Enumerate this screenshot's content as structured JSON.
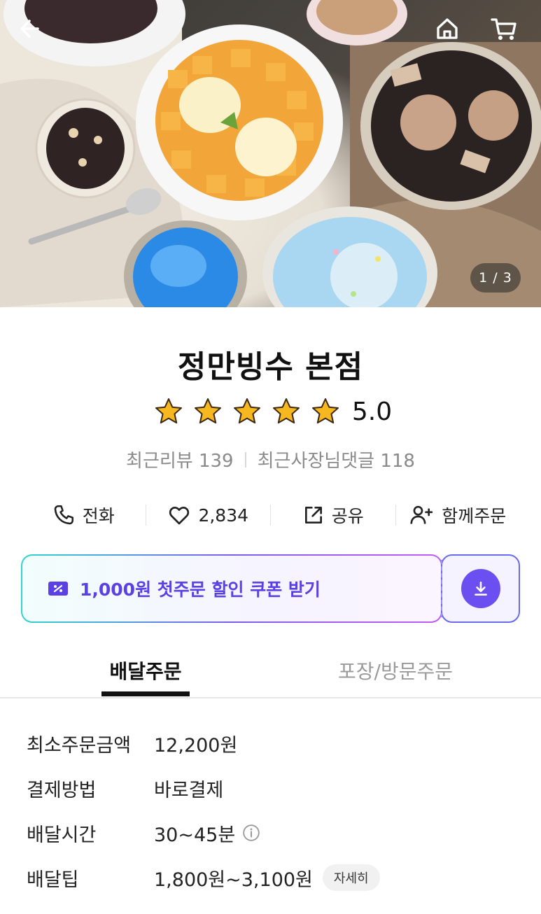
{
  "header": {
    "back_icon": "arrow-left-icon",
    "home_icon": "home-icon",
    "cart_icon": "cart-icon",
    "page_indicator": "1 / 3"
  },
  "store": {
    "name": "정만빙수 본점",
    "rating": 5,
    "rating_label": "5.0",
    "star_color": "#f7b81f",
    "reviews_label": "최근리뷰 139",
    "owner_replies_label": "최근사장님댓글 118"
  },
  "actions": {
    "call": "전화",
    "likes": "2,834",
    "share": "공유",
    "group_order": "함께주문"
  },
  "coupon": {
    "text": "1,000원 첫주문 할인 쿠폰 받기",
    "accent": "#5b40e6"
  },
  "tabs": {
    "delivery": "배달주문",
    "pickup": "포장/방문주문"
  },
  "info": [
    {
      "label": "최소주문금액",
      "value": "12,200원"
    },
    {
      "label": "결제방법",
      "value": "바로결제"
    },
    {
      "label": "배달시간",
      "value": "30~45분"
    },
    {
      "label": "배달팁",
      "value": "1,800원~3,100원",
      "button": "자세히"
    }
  ]
}
